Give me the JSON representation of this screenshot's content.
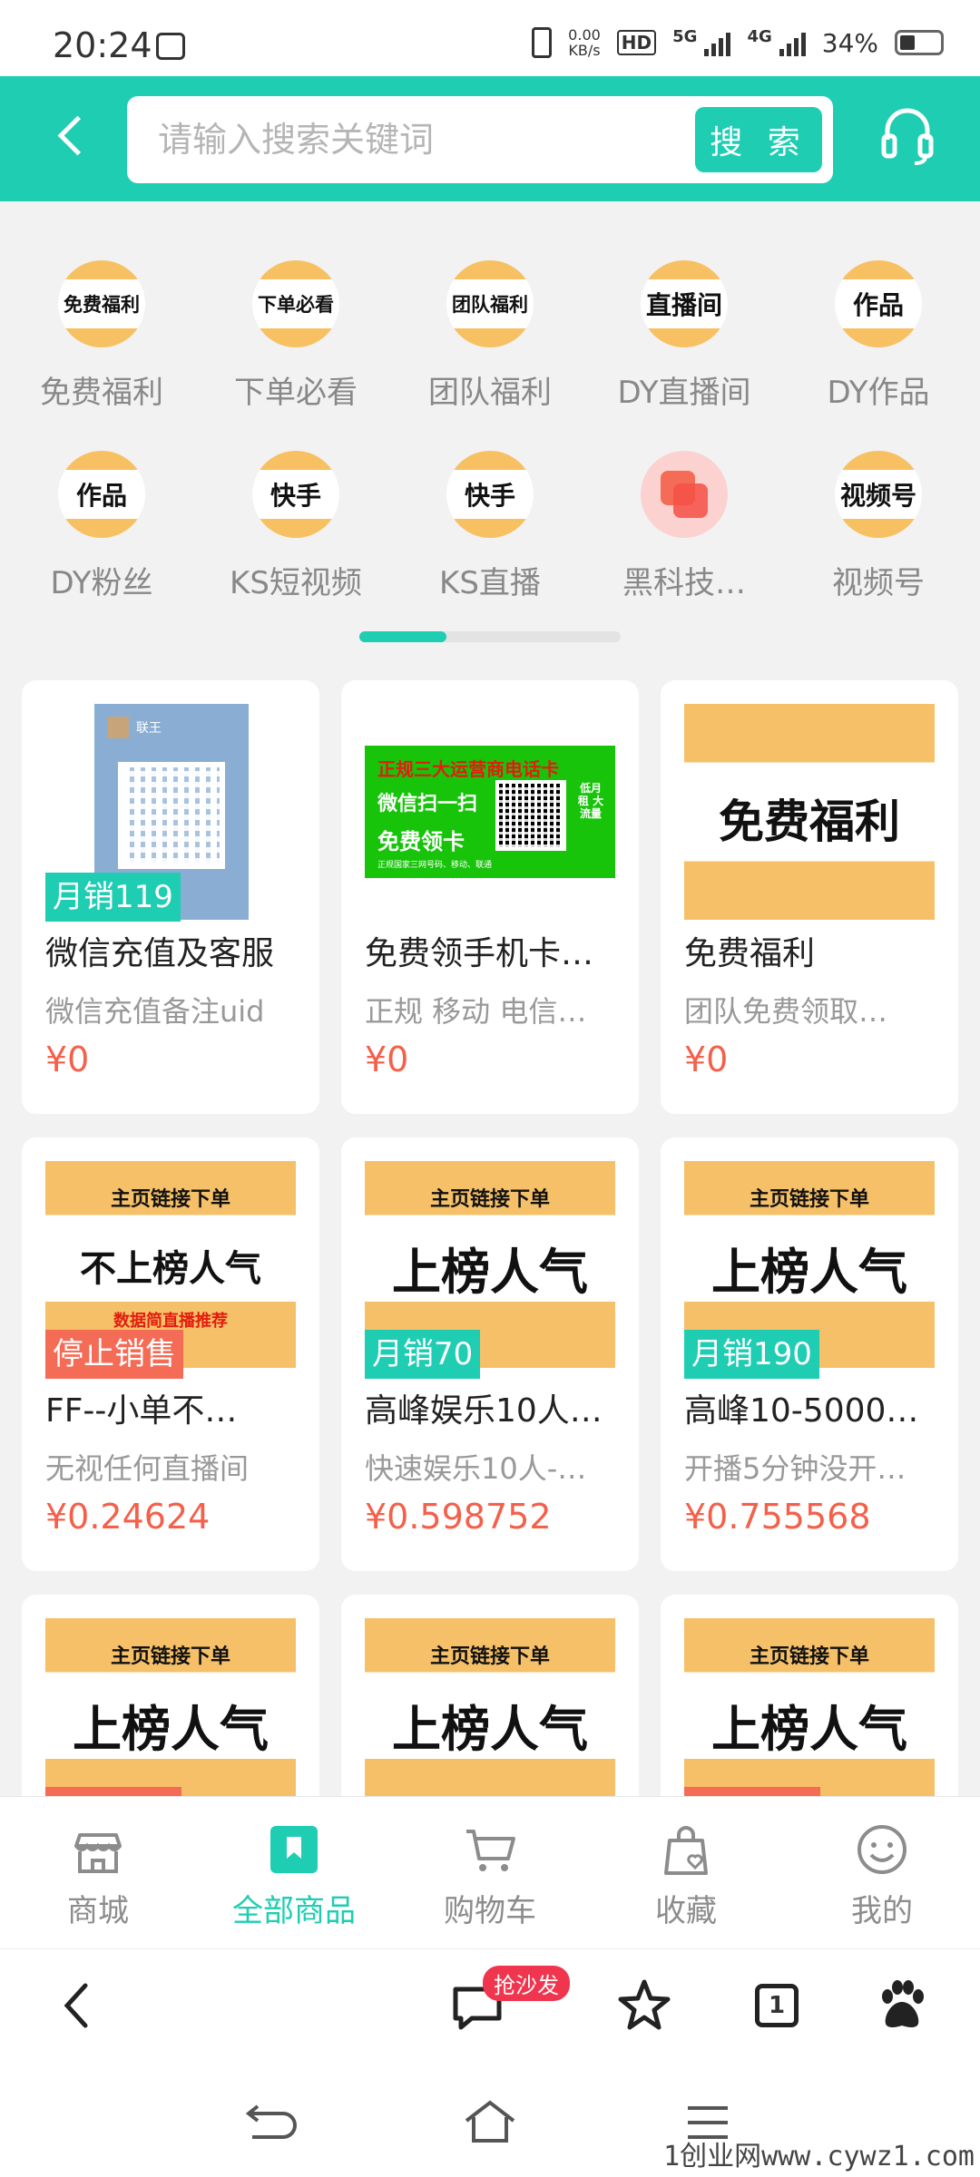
{
  "status_bar": {
    "time": "20:24",
    "speed_value": "0.00",
    "speed_unit": "KB/s",
    "hd": "HD",
    "net1": "5G",
    "net2": "4G",
    "battery": "34%"
  },
  "header": {
    "search_placeholder": "请输入搜索关键词",
    "search_button": "搜 索",
    "icons": [
      "back-arrow-icon",
      "headset-icon"
    ]
  },
  "categories": [
    {
      "icon_text": "免费福利",
      "label": "免费福利"
    },
    {
      "icon_text": "下单必看",
      "label": "下单必看"
    },
    {
      "icon_text": "团队福利",
      "label": "团队福利"
    },
    {
      "icon_text": "直播间",
      "label": "DY直播间"
    },
    {
      "icon_text": "作品",
      "label": "DY作品"
    },
    {
      "icon_text": "作品",
      "label": "DY粉丝"
    },
    {
      "icon_text": "快手",
      "label": "KS短视频"
    },
    {
      "icon_text": "快手",
      "label": "KS直播"
    },
    {
      "icon_text": "",
      "label": "黑科技…"
    },
    {
      "icon_text": "视频号",
      "label": "视频号"
    }
  ],
  "carousel": {
    "page_fraction": 0.333
  },
  "products": [
    {
      "title": "微信充值及客服",
      "subtitle": "微信充值备注uid",
      "price": "¥0",
      "badge": "月销119",
      "image": {
        "name": "联王"
      }
    },
    {
      "title": "免费领手机卡…",
      "subtitle": "正规 移动 电信…",
      "price": "¥0",
      "image": {
        "line1": "正规三大运营商电话卡",
        "line2": "微信扫一扫",
        "line3": "免费领卡",
        "line4": "正规国家三网号码、移动、联通",
        "side": "低月租 大流量"
      }
    },
    {
      "title": "免费福利",
      "subtitle": "团队免费领取…",
      "price": "¥0",
      "image": {
        "text": "免费福利"
      }
    },
    {
      "title": "FF--小单不…",
      "subtitle": "无视任何直播间",
      "price": "¥0.24624",
      "badge": "停止销售",
      "image": {
        "top": "主页链接下单",
        "big": "不上榜人气",
        "red": "数据简直播推荐"
      }
    },
    {
      "title": "高峰娱乐10人…",
      "subtitle": "快速娱乐10人-…",
      "price": "¥0.598752",
      "badge": "月销70",
      "image": {
        "top": "主页链接下单",
        "big": "上榜人气"
      }
    },
    {
      "title": "高峰10-5000…",
      "subtitle": "开播5分钟没开…",
      "price": "¥0.755568",
      "badge": "月销190",
      "image": {
        "top": "主页链接下单",
        "big": "上榜人气"
      }
    },
    {
      "image": {
        "top": "主页链接下单",
        "big": "上榜人气"
      }
    },
    {
      "image": {
        "top": "主页链接下单",
        "big": "上榜人气"
      }
    },
    {
      "image": {
        "top": "主页链接下单",
        "big": "上榜人气"
      }
    }
  ],
  "tabbar": [
    {
      "label": "商城",
      "icon": "store-icon",
      "active": false
    },
    {
      "label": "全部商品",
      "icon": "bookmark-icon",
      "active": true
    },
    {
      "label": "购物车",
      "icon": "cart-icon",
      "active": false
    },
    {
      "label": "收藏",
      "icon": "favorite-bag-icon",
      "active": false
    },
    {
      "label": "我的",
      "icon": "smiley-icon",
      "active": false
    }
  ],
  "browser_bar": {
    "comment_badge": "抢沙发",
    "tab_count": "1",
    "icons": [
      "back-icon",
      "comment-icon",
      "star-icon",
      "tabs-icon",
      "baidu-paw-icon"
    ]
  },
  "watermark": "1创业网www.cywz1.com",
  "colors": {
    "accent": "#1ecdb2",
    "price": "#f4604a",
    "badge_red": "#f46b56",
    "card_yellow": "#f5c067"
  }
}
